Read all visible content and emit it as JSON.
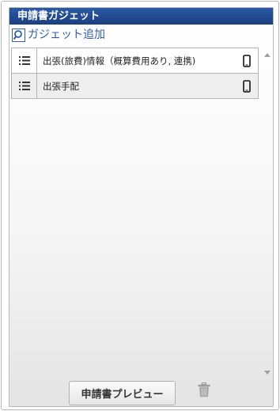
{
  "panel": {
    "title": "申請書ガジェット",
    "add_gadget_label": "ガジェット追加",
    "add_gadget_icon": "search-add-icon"
  },
  "gadgets": [
    {
      "label": "出張(旅費)情報（概算費用あり, 連携)",
      "handle_icon": "list-handle-icon",
      "device_icon": "mobile-icon"
    },
    {
      "label": "出張手配",
      "handle_icon": "list-handle-icon",
      "device_icon": "mobile-icon"
    }
  ],
  "footer": {
    "preview_label": "申請書プレビュー",
    "trash_icon": "trash-icon"
  },
  "colors": {
    "header_bg": "#1f4a8c",
    "link": "#2e5ea8",
    "border": "#b4b4b4"
  }
}
